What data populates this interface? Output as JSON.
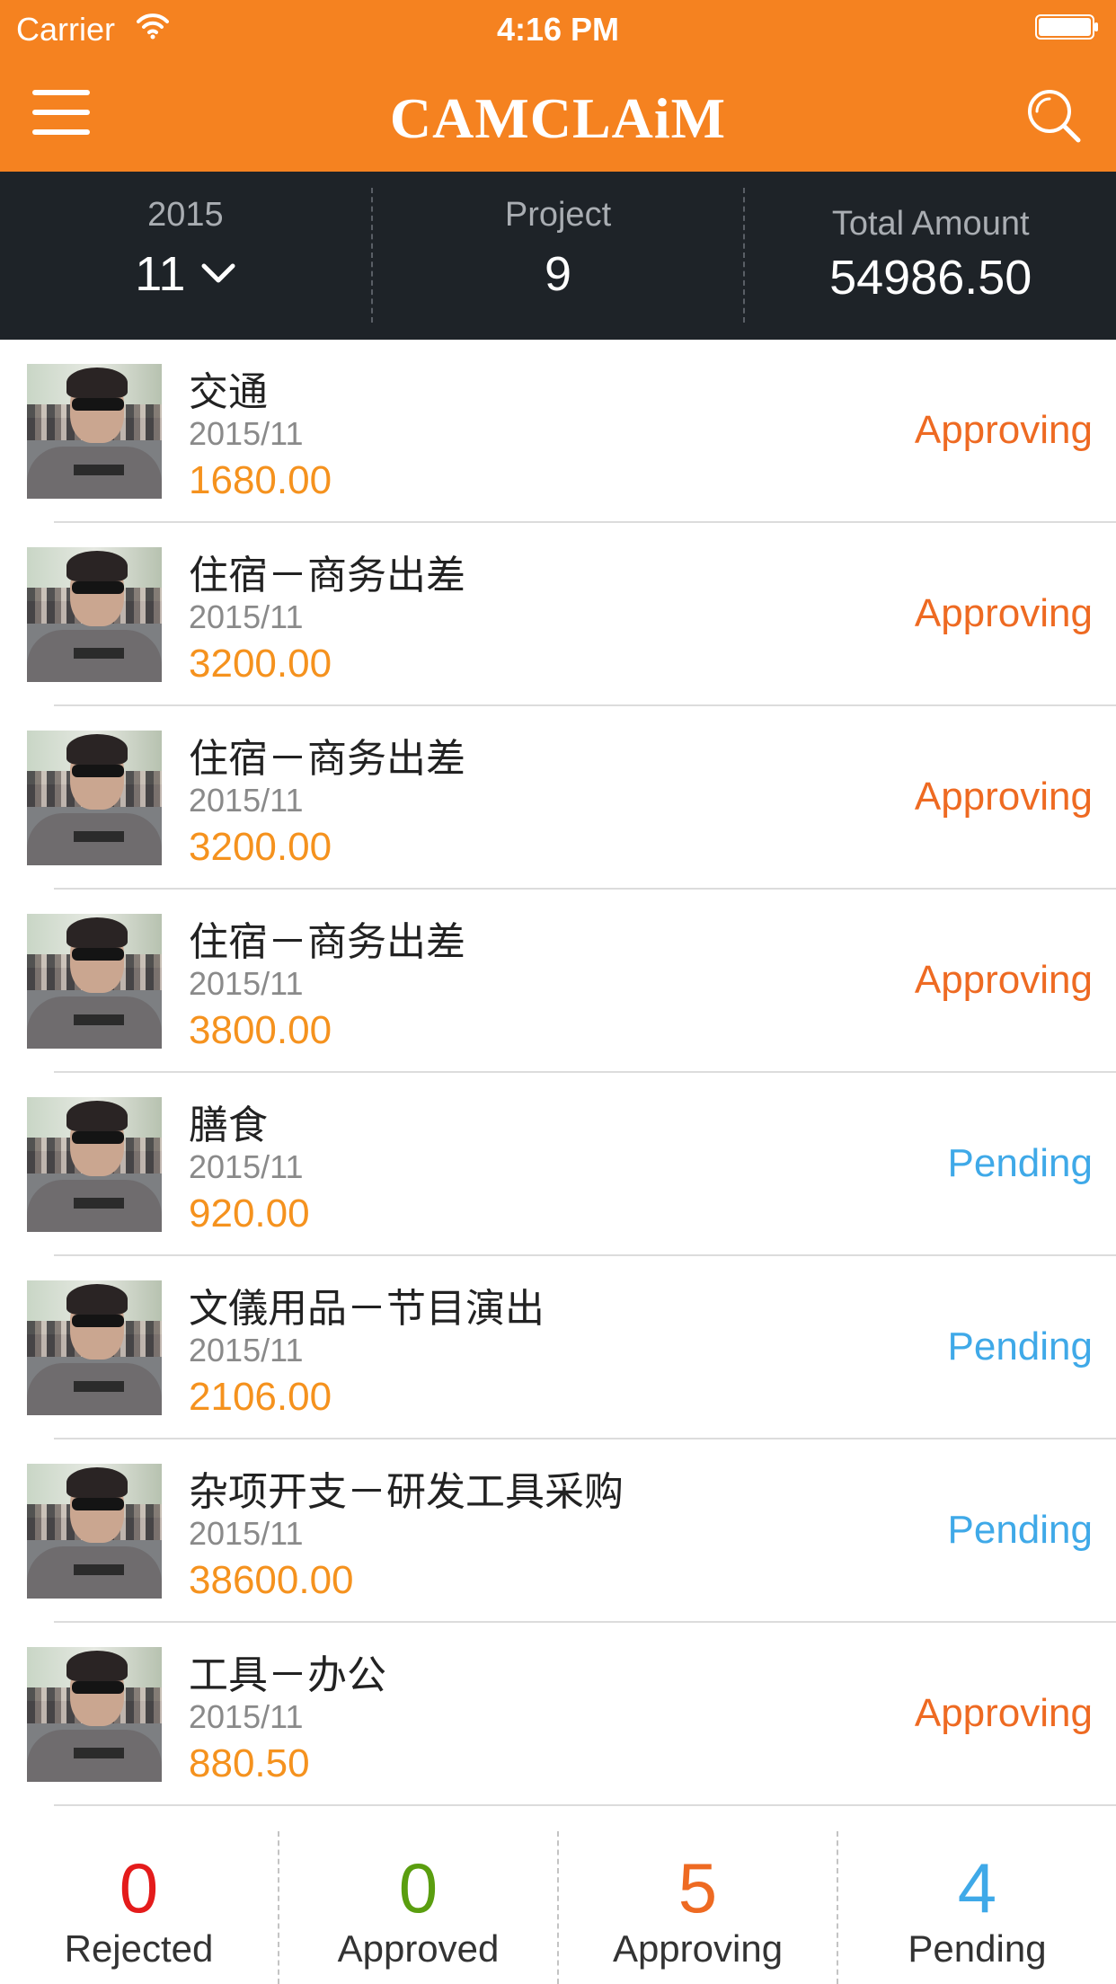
{
  "status_bar": {
    "carrier": "Carrier",
    "time": "4:16 PM"
  },
  "nav": {
    "logo": "CAMCLAiM"
  },
  "colors": {
    "brand_orange": "#f58220",
    "amount_orange": "#f5921e",
    "approving": "#ee6a22",
    "pending": "#3fa9e8",
    "rejected": "#e41b1b",
    "approved": "#5a9e0f"
  },
  "icons": [
    "wifi-icon",
    "battery-icon",
    "menu-icon",
    "search-icon",
    "chevron-down-icon"
  ],
  "summary": {
    "year": "2015",
    "month": "11",
    "project_label": "Project",
    "project_value": "9",
    "total_label": "Total Amount",
    "total_value": "54986.50"
  },
  "claims": [
    {
      "title": "交通",
      "date": "2015/11",
      "amount": "1680.00",
      "status": "Approving"
    },
    {
      "title": "住宿－商务出差",
      "date": "2015/11",
      "amount": "3200.00",
      "status": "Approving"
    },
    {
      "title": "住宿－商务出差",
      "date": "2015/11",
      "amount": "3200.00",
      "status": "Approving"
    },
    {
      "title": "住宿－商务出差",
      "date": "2015/11",
      "amount": "3800.00",
      "status": "Approving"
    },
    {
      "title": "膳食",
      "date": "2015/11",
      "amount": "920.00",
      "status": "Pending"
    },
    {
      "title": "文儀用品－节目演出",
      "date": "2015/11",
      "amount": "2106.00",
      "status": "Pending"
    },
    {
      "title": "杂项开支－研发工具采购",
      "date": "2015/11",
      "amount": "38600.00",
      "status": "Pending"
    },
    {
      "title": "工具－办公",
      "date": "2015/11",
      "amount": "880.50",
      "status": "Approving"
    }
  ],
  "counts": [
    {
      "count": "0",
      "label": "Rejected"
    },
    {
      "count": "0",
      "label": "Approved"
    },
    {
      "count": "5",
      "label": "Approving"
    },
    {
      "count": "4",
      "label": "Pending"
    }
  ]
}
